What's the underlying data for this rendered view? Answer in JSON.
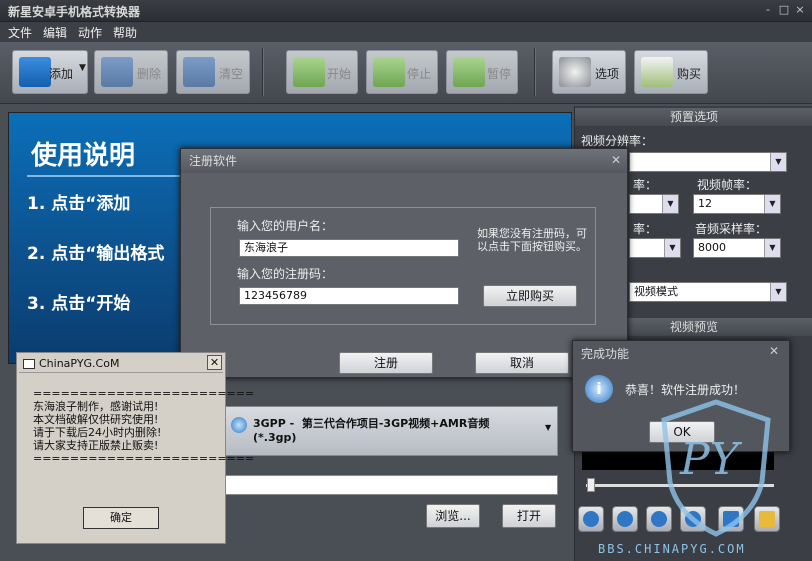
{
  "window": {
    "title": "新星安卓手机格式转换器",
    "controls": [
      "-",
      "□",
      "×"
    ]
  },
  "menu": [
    "文件",
    "编辑",
    "动作",
    "帮助"
  ],
  "toolbar": {
    "add": "添加",
    "delete": "删除",
    "clear": "清空",
    "start": "开始",
    "stop": "停止",
    "pause": "暂停",
    "options": "选项",
    "buy": "购买"
  },
  "preview": {
    "heading": "使用说明",
    "step1": "1. 点击“添加",
    "step2": "2. 点击“输出格式",
    "step3": "3. 点击“开始"
  },
  "right": {
    "preset_title": "预置选项",
    "video_resolution": "视频分辨率：",
    "rate_a": "率：",
    "video_fps": "视频帧率：",
    "fps_value": "12",
    "rate_b": "率：",
    "audio_sample": "音频采样率：",
    "sample_value": "8000",
    "mode_prefix": "：",
    "mode_value": "视频模式",
    "video_preview": "视频预览"
  },
  "format": {
    "name": "3GPP -  第三代合作项目-3GP视频+AMR音频",
    "ext": "(*.3gp)"
  },
  "bottom": {
    "browse": "浏览...",
    "open": "打开"
  },
  "register": {
    "title": "注册软件",
    "user_label": "输入您的用户名：",
    "user_value": "东海浪子",
    "code_label": "输入您的注册码：",
    "code_value": "123456789",
    "hint": "如果您没有注册码，可以点击下面按钮购买。",
    "buy_now": "立即购买",
    "register": "注册",
    "cancel": "取消"
  },
  "chinapyg": {
    "title": "ChinaPYG.CoM",
    "sep": "========================",
    "line1": "东海浪子制作，感谢试用!",
    "line2": "本文档破解仅供研究使用!",
    "line3": "请于下载后24小时内删除!",
    "line4": "请大家支持正版禁止贩卖!",
    "ok": "确定"
  },
  "done": {
    "title": "完成功能",
    "message": "恭喜！软件注册成功！",
    "ok": "OK"
  },
  "watermark": {
    "text": "BBS.CHINAPYG.COM",
    "logo": "PY"
  },
  "colors": {
    "accent": "#2f77c5",
    "preview_bg": "#0b6fb8",
    "watermark": "#8fc3e8"
  }
}
